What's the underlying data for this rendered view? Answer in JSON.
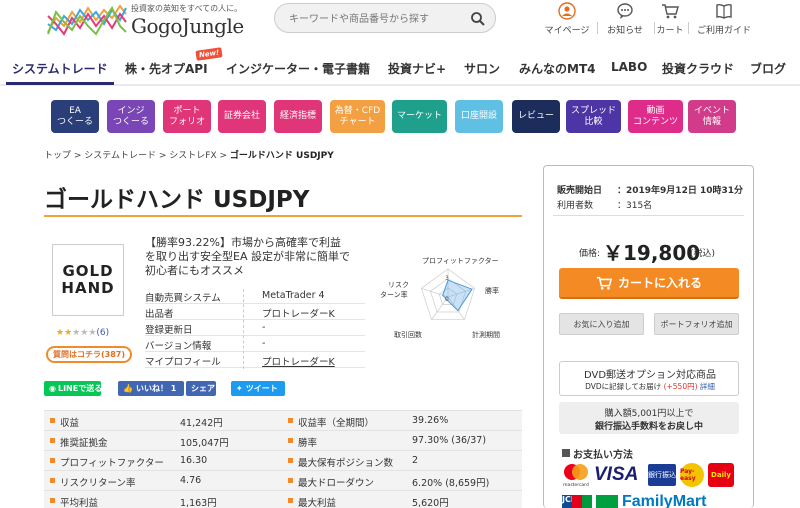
{
  "header": {
    "tagline": "投資家の英知をすべての人に。",
    "logo": "GogoJungle",
    "search_placeholder": "キーワードや商品番号から探す",
    "nav": [
      {
        "label": "マイページ",
        "icon": "user-icon"
      },
      {
        "label": "お知らせ",
        "icon": "chat-bubble-icon"
      },
      {
        "label": "カート",
        "icon": "cart-icon"
      },
      {
        "label": "ご利用ガイド",
        "icon": "book-icon"
      }
    ]
  },
  "main_nav": {
    "items": [
      "システムトレード",
      "株・先オプAPI",
      "インジケーター・電子書籍",
      "投資ナビ+",
      "サロン",
      "みんなのMT4",
      "LABO",
      "投資クラウド",
      "ブログ"
    ],
    "new_badge": "New!"
  },
  "categories": [
    {
      "label": "EA\nつくーる",
      "color": "#2a3e79"
    },
    {
      "label": "インジ\nつくーる",
      "color": "#7a45b5"
    },
    {
      "label": "ポート\nフォリオ",
      "color": "#e1357a"
    },
    {
      "label": "証券会社",
      "color": "#e1357a"
    },
    {
      "label": "経済指標",
      "color": "#e1357a"
    },
    {
      "label": "為替・CFD\nチャート",
      "color": "#f2a042"
    },
    {
      "label": "マーケット",
      "color": "#1fa08d"
    },
    {
      "label": "口座開設",
      "color": "#5fc0e4"
    },
    {
      "label": "レビュー",
      "color": "#1c2d5c"
    },
    {
      "label": "スプレッド\n比較",
      "color": "#4e35a6"
    },
    {
      "label": "動画\nコンテンツ",
      "color": "#de2c8a"
    },
    {
      "label": "イベント\n情報",
      "color": "#d23a8a"
    }
  ],
  "breadcrumb": {
    "items": [
      "トップ",
      "システムトレード",
      "シストレFX"
    ],
    "current": "ゴールドハンド USDJPY"
  },
  "product": {
    "title": "ゴールドハンド USDJPY",
    "logo_text": "GOLD\nHAND",
    "rating_count": "(6)",
    "rating_value": 2,
    "qa_badge": "質問はコチラ(387)",
    "description": "【勝率93.22%】市場から高確率で利益\nを取り出す安全型EA 設定が非常に簡単で\n初心者にもオススメ",
    "specs": [
      {
        "label": "自動売買システム",
        "value": "MetaTrader 4"
      },
      {
        "label": "出品者",
        "value": "プロトレーダーK"
      },
      {
        "label": "登録更新日",
        "value": "-"
      },
      {
        "label": "バージョン情報",
        "value": "-"
      },
      {
        "label": "マイプロフィール",
        "value": "プロトレーダーK"
      }
    ]
  },
  "radar": {
    "labels": [
      "プロフィットファクター",
      "勝率",
      "計測期間",
      "取引回数",
      "リスク\nターン率"
    ],
    "scale": [
      "3",
      "0"
    ],
    "values": [
      3,
      4.5,
      3,
      0.5,
      1
    ]
  },
  "social": {
    "line": "LINEで送る",
    "like": "いいね！ 1",
    "share": "シェア",
    "tweet": "ツイート"
  },
  "stats": [
    {
      "l1": "収益",
      "v1": "41,242円",
      "l2": "収益率（全期間）",
      "v2": "39.26%"
    },
    {
      "l1": "推奨証拠金",
      "v1": "105,047円",
      "l2": "勝率",
      "v2": "97.30% (36/37)"
    },
    {
      "l1": "プロフィットファクター",
      "v1": "16.30",
      "l2": "最大保有ポジション数",
      "v2": "2"
    },
    {
      "l1": "リスクリターン率",
      "v1": "4.76",
      "l2": "最大ドローダウン",
      "v2": "6.20% (8,659円)"
    },
    {
      "l1": "平均利益",
      "v1": "1,163円",
      "l2": "最大利益",
      "v2": "5,620円"
    }
  ],
  "purchase": {
    "pub_label": "販売開始日",
    "pub_value": "：2019年9月12日 10時31分",
    "users_label": "利用者数",
    "users_value": "：315名",
    "price_label": "価格:",
    "price": "￥19,800",
    "price_tax": "(税込)",
    "cart_button": "カートに入れる",
    "favorite_button": "お気に入り追加",
    "portfolio_button": "ポートフォリオ追加",
    "dvd_title": "DVD郵送オプション対応商品",
    "dvd_sub": "DVDに記録してお届け",
    "dvd_price": "(+550円)",
    "dvd_link": "詳細",
    "bank_line1": "購入額5,001円以上で",
    "bank_line2": "銀行振込手数料をお戻し中",
    "payment_title": "お支払い方法",
    "payment_methods": [
      "mastercard",
      "VISA",
      "銀行振込",
      "Pay-easy",
      "Daily",
      "JCB",
      "FamilyMart"
    ]
  }
}
